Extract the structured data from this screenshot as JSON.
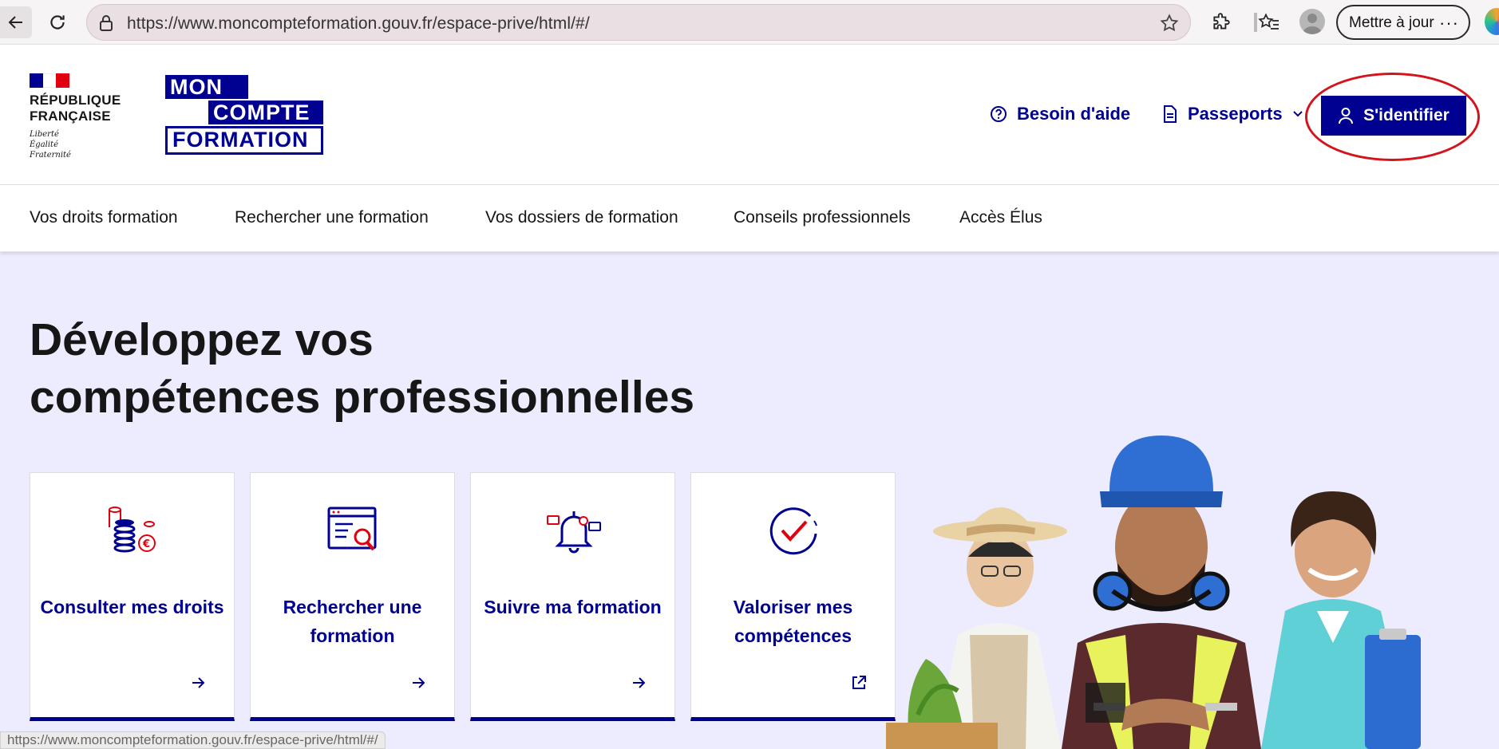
{
  "browser": {
    "url": "https://www.moncompteformation.gouv.fr/espace-prive/html/#/",
    "update_label": "Mettre à jour",
    "more_label": "···"
  },
  "header": {
    "republique": "RÉPUBLIQUE FRANÇAISE",
    "motto": [
      "Liberté",
      "Égalité",
      "Fraternité"
    ],
    "logo": [
      "MON",
      "COMPTE",
      "FORMATION"
    ],
    "help_label": "Besoin d'aide",
    "passports_label": "Passeports",
    "signin_label": "S'identifier"
  },
  "nav": {
    "items": [
      "Vos droits formation",
      "Rechercher une formation",
      "Vos dossiers de formation",
      "Conseils professionnels",
      "Accès Élus"
    ]
  },
  "hero": {
    "title_line1": "Développez vos",
    "title_line2": "compétences professionnelles",
    "cards": [
      {
        "label": "Consulter mes droits",
        "icon": "coins-euro-icon",
        "arrow": "arrow-right-icon"
      },
      {
        "label": "Rechercher une formation",
        "icon": "search-document-icon",
        "arrow": "arrow-right-icon"
      },
      {
        "label": "Suivre ma formation",
        "icon": "bell-notification-icon",
        "arrow": "arrow-right-icon"
      },
      {
        "label": "Valoriser mes compétences",
        "icon": "checkmark-circle-icon",
        "arrow": "external-link-icon"
      }
    ]
  },
  "status_bar": {
    "url": "https://www.moncompteformation.gouv.fr/espace-prive/html/#/"
  },
  "colors": {
    "brand_blue": "#000091",
    "marianne_red": "#e1000f",
    "hero_background": "#ececfe",
    "annotation_red": "#d4141c"
  }
}
